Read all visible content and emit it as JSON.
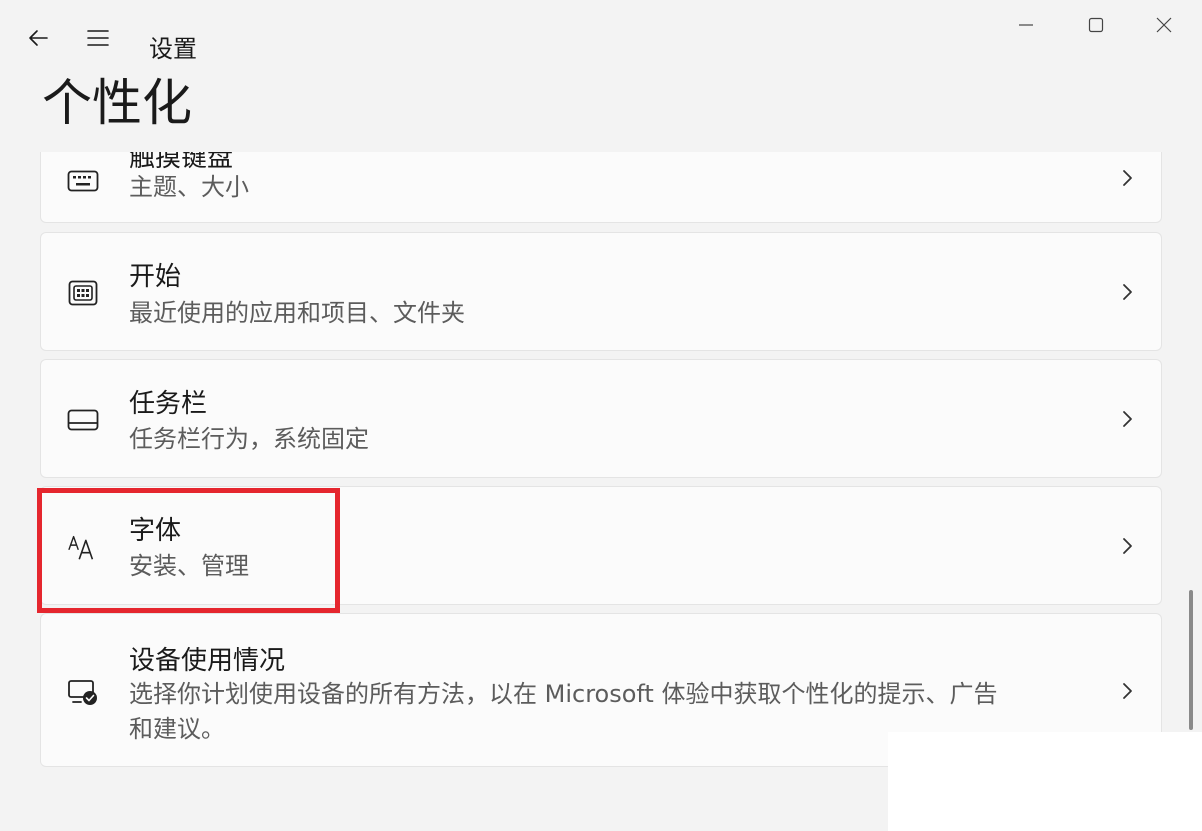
{
  "window": {
    "app_title": "设置"
  },
  "page": {
    "title": "个性化"
  },
  "items": [
    {
      "title": "触摸键盘",
      "desc": "主题、大小",
      "icon": "keyboard-icon"
    },
    {
      "title": "开始",
      "desc": "最近使用的应用和项目、文件夹",
      "icon": "start-icon"
    },
    {
      "title": "任务栏",
      "desc": "任务栏行为，系统固定",
      "icon": "taskbar-icon"
    },
    {
      "title": "字体",
      "desc": "安装、管理",
      "icon": "font-icon"
    },
    {
      "title": "设备使用情况",
      "desc_line1": "选择你计划使用设备的所有方法，以在 Microsoft 体验中获取个性化的提示、广告",
      "desc_line2": "和建议。",
      "icon": "device-usage-icon"
    }
  ],
  "colors": {
    "background": "#f3f3f3",
    "card": "#fbfbfb",
    "highlight": "#e5262e"
  }
}
